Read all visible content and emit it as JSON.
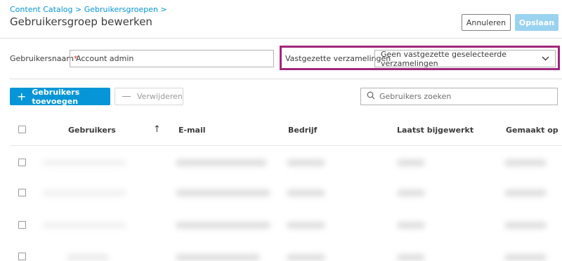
{
  "breadcrumb": {
    "item1": "Content Catalog",
    "sep1": " > ",
    "item2": "Gebruikersgroepen",
    "sep2": " >"
  },
  "page_title": "Gebruikersgroep bewerken",
  "header_actions": {
    "cancel_label": "Annuleren",
    "save_label": "Opslaan"
  },
  "form": {
    "username_label": "Gebruikersnaam",
    "required_mark": "*",
    "username_value": "Account admin",
    "pinned_label": "Vastgezette verzamelingen",
    "pinned_value": "Geen vastgezette geselecteerde verzamelingen"
  },
  "toolbar": {
    "add_users_label": "Gebruikers toevoegen",
    "add_icon": "+",
    "remove_label": "Verwijderen",
    "search_placeholder": "Gebruikers zoeken"
  },
  "table": {
    "columns": [
      "Gebruikers",
      "E-mail",
      "Bedrijf",
      "Laatst bijgewerkt",
      "Gemaakt op"
    ],
    "sort_icon": "↑",
    "row_count_visible": 4
  },
  "colors": {
    "accent": "#0696d7",
    "highlight_frame": "#a0267a",
    "required": "#e0372c",
    "save_disabled": "#9ad3f0"
  },
  "icons": [
    "plus-icon",
    "minus-icon",
    "search-icon",
    "chevron-down-icon",
    "sort-up-arrow-icon",
    "checkbox-icon"
  ]
}
